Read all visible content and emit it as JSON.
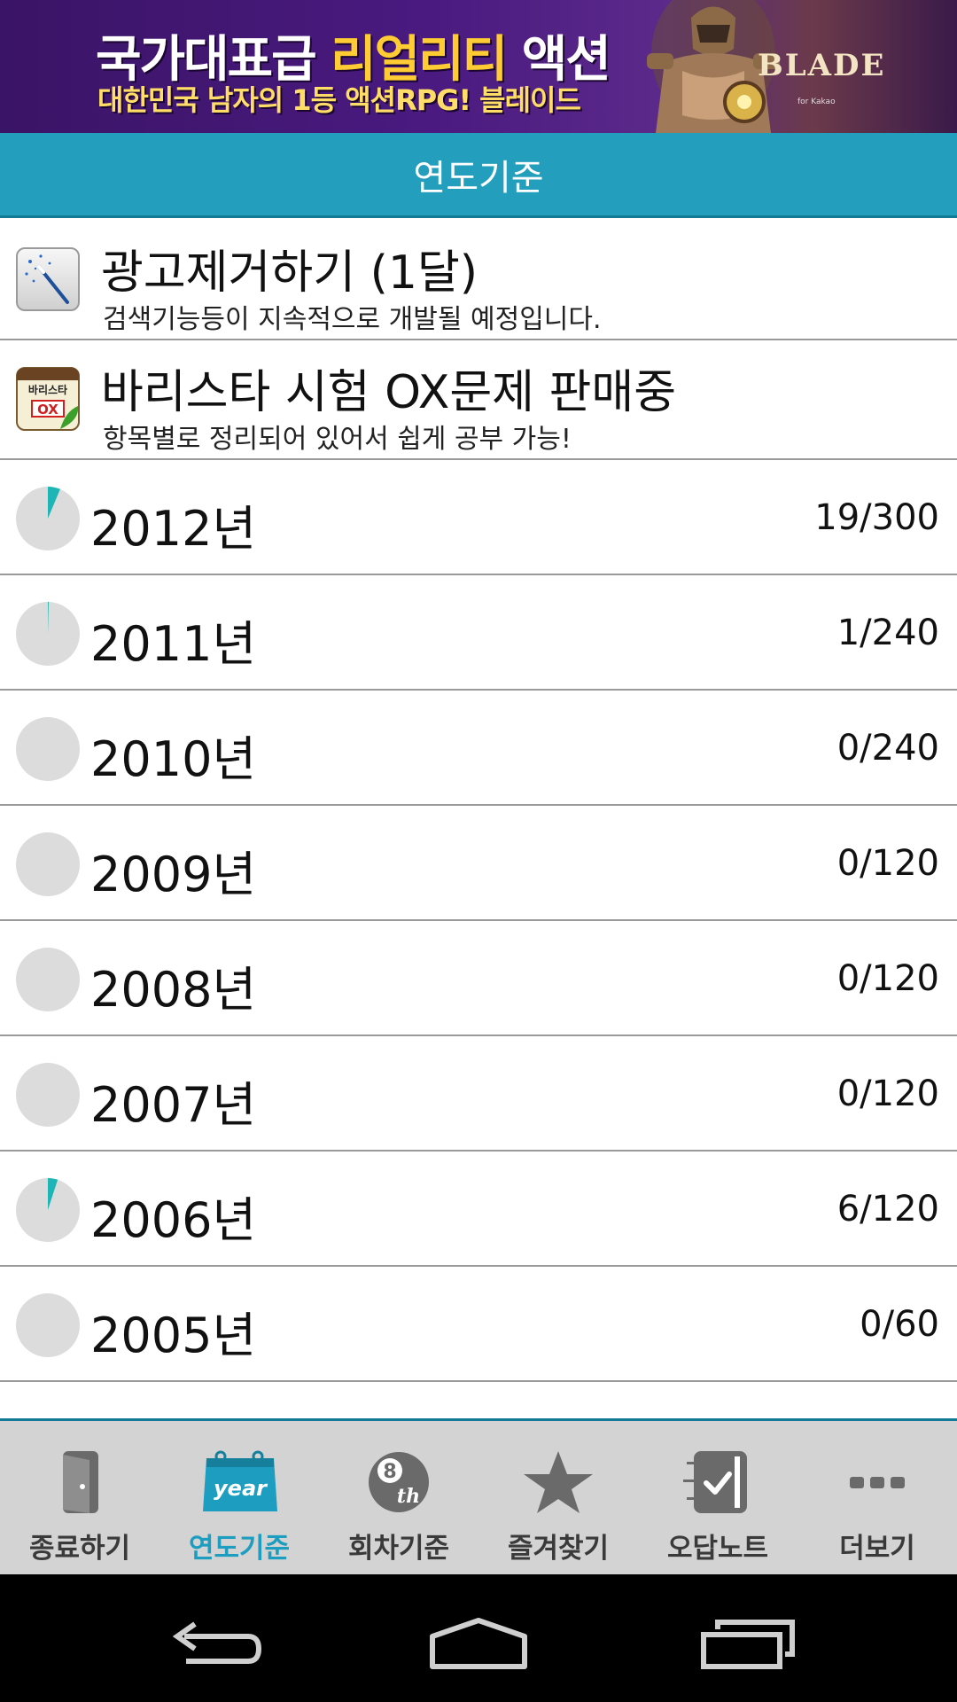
{
  "banner": {
    "line1_part1": "국가대표급 ",
    "line1_highlight": "리얼리티",
    "line1_part2": " 액션",
    "line2": "대한민국 남자의 1등 액션RPG! 블레이드",
    "logo": "BLADE",
    "logo_sub": "for Kakao"
  },
  "header": {
    "title": "연도기준"
  },
  "promos": [
    {
      "title": "광고제거하기 (1달)",
      "subtitle": "검색기능등이 지속적으로 개발될 예정입니다.",
      "icon": "magic-wand-icon"
    },
    {
      "title": "바리스타 시험 OX문제 판매중",
      "subtitle": "항목별로 정리되어 있어서 쉽게 공부 가능!",
      "icon": "barista-ox-app-icon",
      "icon_text_top": "바리스타",
      "icon_text_ox": "OX"
    }
  ],
  "years": [
    {
      "label": "2012년",
      "count": "19/300",
      "progress": 0.0633
    },
    {
      "label": "2011년",
      "count": "1/240",
      "progress": 0.0042
    },
    {
      "label": "2010년",
      "count": "0/240",
      "progress": 0
    },
    {
      "label": "2009년",
      "count": "0/120",
      "progress": 0
    },
    {
      "label": "2008년",
      "count": "0/120",
      "progress": 0
    },
    {
      "label": "2007년",
      "count": "0/120",
      "progress": 0
    },
    {
      "label": "2006년",
      "count": "6/120",
      "progress": 0.05
    },
    {
      "label": "2005년",
      "count": "0/60",
      "progress": 0
    }
  ],
  "tabs": [
    {
      "label": "종료하기",
      "icon": "exit-door-icon"
    },
    {
      "label": "연도기준",
      "icon": "year-calendar-icon",
      "icon_text": "year",
      "active": true
    },
    {
      "label": "회차기준",
      "icon": "eight-ball-icon",
      "icon_text": "8",
      "icon_text_sup": "th"
    },
    {
      "label": "즐겨찾기",
      "icon": "star-icon"
    },
    {
      "label": "오답노트",
      "icon": "checked-notebook-icon"
    },
    {
      "label": "더보기",
      "icon": "more-dots-icon"
    }
  ],
  "colors": {
    "accent": "#239fbd",
    "accent_dark": "#127a94",
    "pie_fill": "#1db5b5",
    "pie_bg": "#dcdcdc",
    "tab_bg": "#d3d3d3",
    "tab_active": "#1d9ec0"
  },
  "navbar": {
    "buttons": [
      "back-icon",
      "home-icon",
      "recent-apps-icon"
    ]
  }
}
